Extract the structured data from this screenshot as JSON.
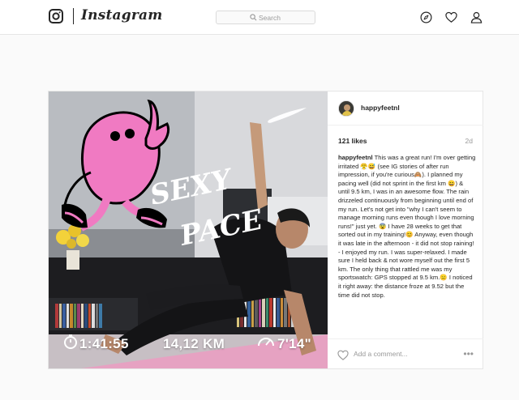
{
  "app": {
    "wordmark": "Instagram"
  },
  "nav": {
    "search_placeholder": "Search",
    "icons": [
      "instagram-camera-icon",
      "compass-icon",
      "heart-icon",
      "profile-icon"
    ]
  },
  "post": {
    "image_text": {
      "title_line1": "SEXY",
      "title_line2": "PACE",
      "duration": "1:41:55",
      "distance": "14,12 KM",
      "pace": "7'14\""
    },
    "author": "happyfeetnl",
    "likes": "121 likes",
    "age": "2d",
    "caption_user": "happyfeetnl",
    "caption_text": "This was a great run! I'm over getting irritated 😤😅 (see IG stories of after run impression, if you're curious🙈). I planned my pacing well (did not sprint in the first km 😄) & until 9.5 km, I was in an awesome flow. The rain drizzeled continuously from beginning until end of my run. Let's not get into \"why I can't seem to manage morning runs even though I love morning runs!\" just yet. 😨 I have 28 weeks to get that sorted out in my training!😊 Anyway, even though it was late in the afternoon - it did not stop raining! - I enjoyed my run. I was super-relaxed. I made sure I held back & not wore myself out the first 5 km. The only thing that rattled me was my sportswatch: GPS stopped at 9.5 km.😑 I noticed it right away: the distance froze at 9.52 but the time did not stop.",
    "comment_placeholder": "Add a comment...",
    "more_label": "•••"
  }
}
